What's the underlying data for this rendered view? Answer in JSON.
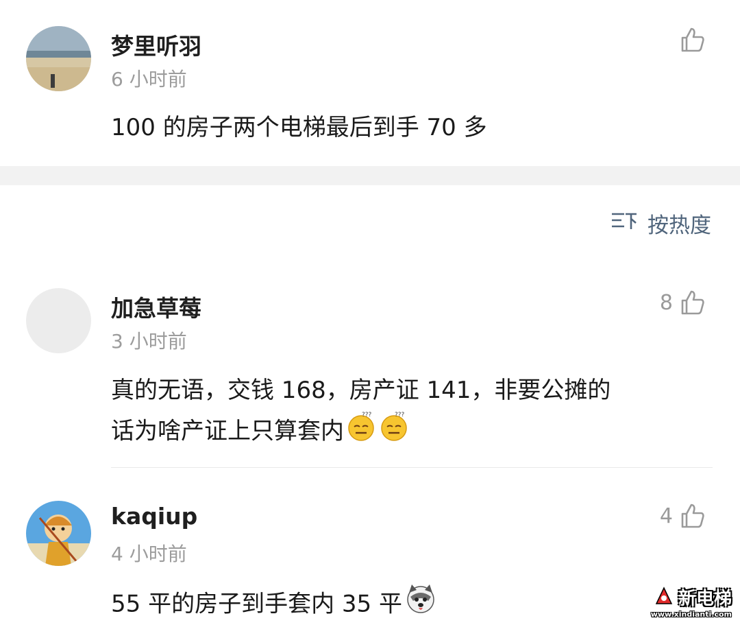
{
  "comments": [
    {
      "username": "梦里听羽",
      "time": "6 小时前",
      "text": "100 的房子两个电梯最后到手 70 多",
      "like_count": "",
      "avatar": "landscape-photo"
    },
    {
      "username": "加急草莓",
      "time": "3 小时前",
      "text_line1": "真的无语，交钱 168，房产证 141，非要公摊的",
      "text_line2": "话为啥产证上只算套内",
      "like_count": "8",
      "avatar": "blank-gray"
    },
    {
      "username": "kaqiup",
      "time": "4 小时前",
      "text": "55 平的房子到手套内 35 平",
      "like_count": "4",
      "avatar": "monkey-king-cartoon"
    }
  ],
  "sort": {
    "label": "按热度",
    "icon": "sort-icon"
  },
  "icons": {
    "like": "thumbs-up-icon",
    "emoji_confused": "dizzy-face-emoji",
    "emoji_husky": "husky-dog-emoji"
  },
  "watermark": {
    "title": "新电梯",
    "url": "www.xindianti.com"
  },
  "colors": {
    "username": "#1f1f1f",
    "time": "#9c9c9c",
    "sort": "#50657c",
    "like": "#9a9a9a",
    "band": "#f2f2f2"
  }
}
